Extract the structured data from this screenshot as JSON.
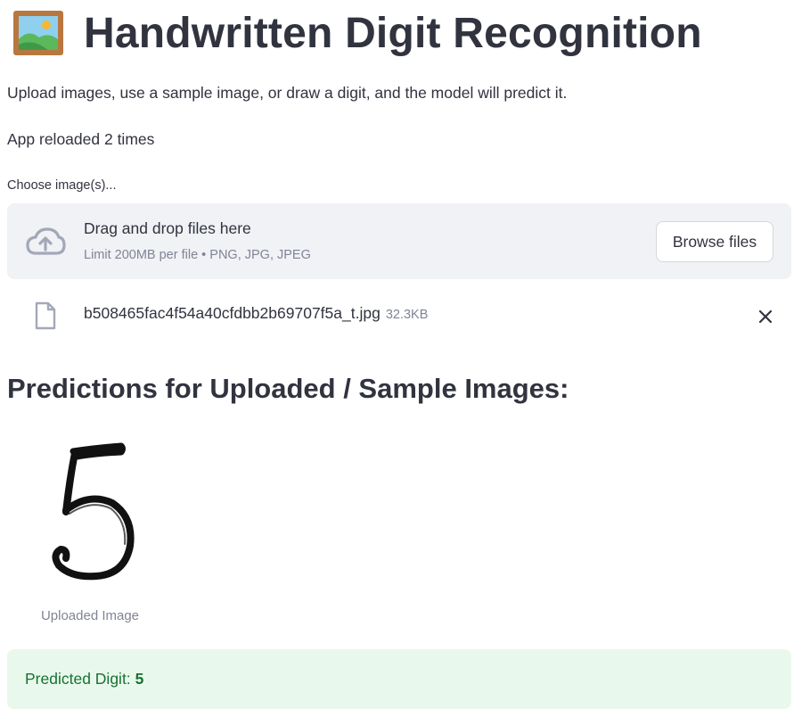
{
  "header": {
    "title": "Handwritten Digit Recognition",
    "icon": "framed-picture-icon"
  },
  "intro": {
    "description": "Upload images, use a sample image, or draw a digit, and the model will predict it.",
    "reload_status": "App reloaded 2 times"
  },
  "uploader": {
    "label": "Choose image(s)...",
    "dropzone_title": "Drag and drop files here",
    "dropzone_limit": "Limit 200MB per file • PNG, JPG, JPEG",
    "browse_label": "Browse files",
    "icon": "cloud-upload-icon",
    "files": [
      {
        "name": "b508465fac4f54a40cfdbb2b69707f5a_t.jpg",
        "size": "32.3KB",
        "icon": "file-icon"
      }
    ]
  },
  "predictions": {
    "heading": "Predictions for Uploaded / Sample Images:",
    "image_caption": "Uploaded Image",
    "result_label": "Predicted Digit:",
    "result_value": "5"
  },
  "colors": {
    "text": "#31333f",
    "muted": "#808495",
    "dropzone_bg": "#f0f2f6",
    "success_bg": "#e9f8ec",
    "success_text": "#177233"
  }
}
